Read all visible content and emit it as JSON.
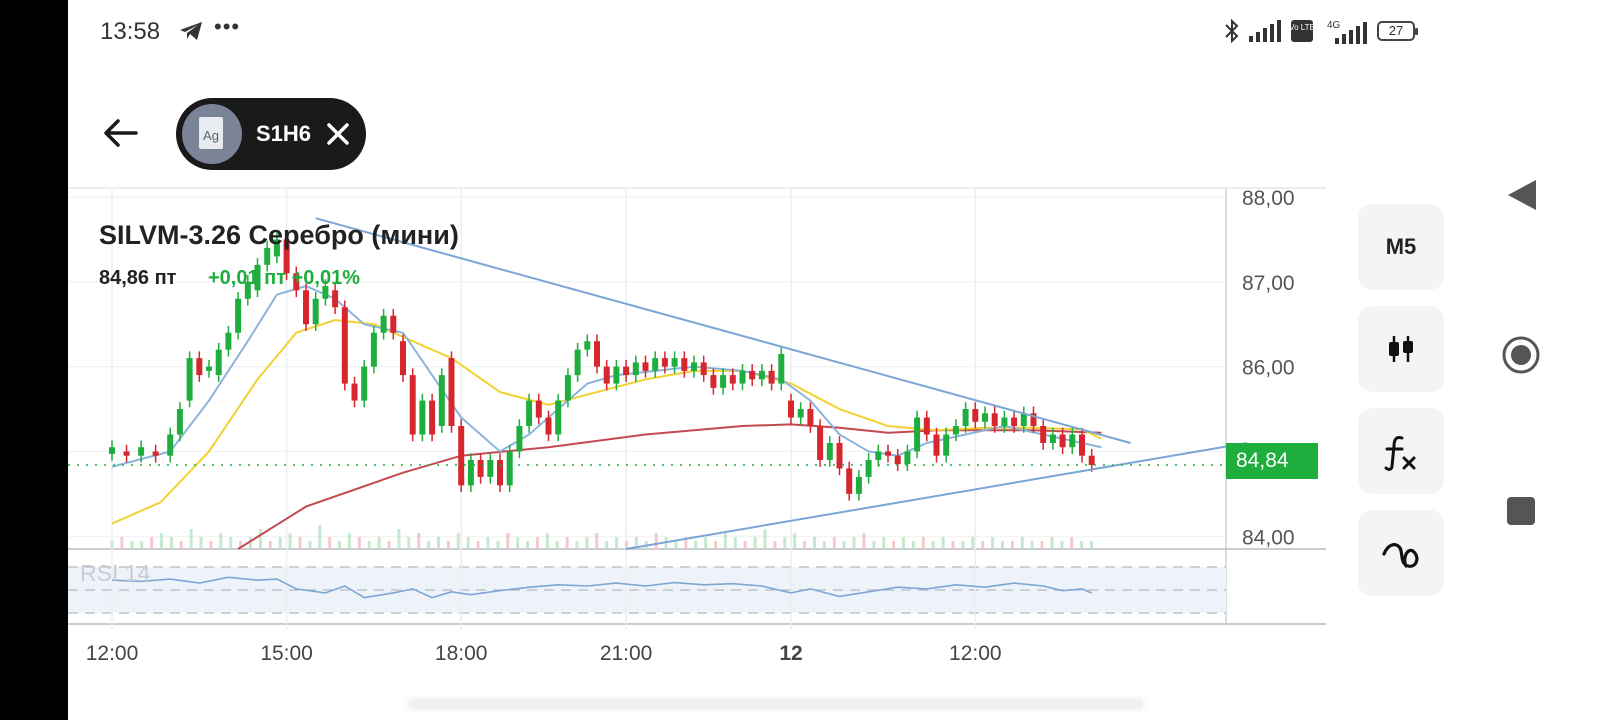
{
  "status_bar": {
    "time": "13:58",
    "dots": "•••",
    "volte": "Vo LTE",
    "network": "4G",
    "battery": "27"
  },
  "header": {
    "instrument_chip_label": "S1H6",
    "chip_logo_text": "Ag"
  },
  "instrument": {
    "title": "SILVM-3.26 Серебро (мини)",
    "price": "84,86 пт",
    "change": "+0,01 пт +0,01%"
  },
  "price_tag": "84,84",
  "rsi_label": "RSI 14",
  "toolbar": {
    "timeframe_label": "M5"
  },
  "colors": {
    "up": "#1fae3d",
    "down": "#d6262e",
    "ma_blue": "#8ab4dc",
    "ma_yellow": "#f2d230",
    "ma_red": "#c44a52",
    "trendline": "#7aa5d6"
  },
  "chart_data": {
    "type": "candlestick",
    "y_ticks": [
      "88,00",
      "87,00",
      "86,00",
      "84,00"
    ],
    "ylim": [
      83.85,
      88.0
    ],
    "x_ticks": [
      "12:00",
      "15:00",
      "18:00",
      "21:00",
      "12",
      "12:00"
    ],
    "x_tick_values": [
      0,
      36,
      72,
      106,
      140,
      178
    ],
    "current_price_line": 84.84,
    "candles": [
      {
        "t": 0,
        "o": 84.97,
        "c": 85.05
      },
      {
        "t": 3,
        "o": 85.0,
        "c": 84.95
      },
      {
        "t": 6,
        "o": 84.95,
        "c": 85.05
      },
      {
        "t": 9,
        "o": 85.0,
        "c": 84.95
      },
      {
        "t": 12,
        "o": 84.95,
        "c": 85.2
      },
      {
        "t": 14,
        "o": 85.2,
        "c": 85.5
      },
      {
        "t": 16,
        "o": 85.6,
        "c": 86.1
      },
      {
        "t": 18,
        "o": 86.1,
        "c": 85.9
      },
      {
        "t": 20,
        "o": 85.95,
        "c": 86.0
      },
      {
        "t": 22,
        "o": 85.9,
        "c": 86.2
      },
      {
        "t": 24,
        "o": 86.2,
        "c": 86.4
      },
      {
        "t": 26,
        "o": 86.4,
        "c": 86.8
      },
      {
        "t": 28,
        "o": 86.8,
        "c": 87.0
      },
      {
        "t": 30,
        "o": 86.9,
        "c": 87.2
      },
      {
        "t": 32,
        "o": 87.2,
        "c": 87.4
      },
      {
        "t": 34,
        "o": 87.3,
        "c": 87.5
      },
      {
        "t": 36,
        "o": 87.5,
        "c": 87.1
      },
      {
        "t": 38,
        "o": 87.1,
        "c": 86.9
      },
      {
        "t": 40,
        "o": 86.9,
        "c": 86.5
      },
      {
        "t": 42,
        "o": 86.5,
        "c": 86.8
      },
      {
        "t": 44,
        "o": 86.8,
        "c": 86.95
      },
      {
        "t": 46,
        "o": 86.9,
        "c": 86.7
      },
      {
        "t": 48,
        "o": 86.7,
        "c": 85.8
      },
      {
        "t": 50,
        "o": 85.8,
        "c": 85.6
      },
      {
        "t": 52,
        "o": 85.6,
        "c": 86.0
      },
      {
        "t": 54,
        "o": 86.0,
        "c": 86.4
      },
      {
        "t": 56,
        "o": 86.4,
        "c": 86.6
      },
      {
        "t": 58,
        "o": 86.6,
        "c": 86.4
      },
      {
        "t": 60,
        "o": 86.3,
        "c": 85.9
      },
      {
        "t": 62,
        "o": 85.9,
        "c": 85.2
      },
      {
        "t": 64,
        "o": 85.2,
        "c": 85.6
      },
      {
        "t": 66,
        "o": 85.6,
        "c": 85.2
      },
      {
        "t": 68,
        "o": 85.3,
        "c": 85.9
      },
      {
        "t": 70,
        "o": 86.1,
        "c": 85.3
      },
      {
        "t": 72,
        "o": 85.3,
        "c": 84.6
      },
      {
        "t": 74,
        "o": 84.6,
        "c": 84.9
      },
      {
        "t": 76,
        "o": 84.9,
        "c": 84.7
      },
      {
        "t": 78,
        "o": 84.7,
        "c": 84.9
      },
      {
        "t": 80,
        "o": 84.9,
        "c": 84.6
      },
      {
        "t": 82,
        "o": 84.6,
        "c": 85.0
      },
      {
        "t": 84,
        "o": 85.0,
        "c": 85.3
      },
      {
        "t": 86,
        "o": 85.3,
        "c": 85.6
      },
      {
        "t": 88,
        "o": 85.6,
        "c": 85.4
      },
      {
        "t": 90,
        "o": 85.4,
        "c": 85.2
      },
      {
        "t": 92,
        "o": 85.2,
        "c": 85.6
      },
      {
        "t": 94,
        "o": 85.6,
        "c": 85.9
      },
      {
        "t": 96,
        "o": 85.9,
        "c": 86.2
      },
      {
        "t": 98,
        "o": 86.2,
        "c": 86.3
      },
      {
        "t": 100,
        "o": 86.3,
        "c": 86.0
      },
      {
        "t": 102,
        "o": 86.0,
        "c": 85.8
      },
      {
        "t": 104,
        "o": 85.8,
        "c": 86.0
      },
      {
        "t": 106,
        "o": 86.0,
        "c": 85.9
      },
      {
        "t": 108,
        "o": 85.9,
        "c": 86.05
      },
      {
        "t": 110,
        "o": 86.05,
        "c": 85.95
      },
      {
        "t": 112,
        "o": 85.95,
        "c": 86.1
      },
      {
        "t": 114,
        "o": 86.1,
        "c": 86.0
      },
      {
        "t": 116,
        "o": 86.0,
        "c": 86.1
      },
      {
        "t": 118,
        "o": 86.1,
        "c": 85.95
      },
      {
        "t": 120,
        "o": 85.95,
        "c": 86.05
      },
      {
        "t": 122,
        "o": 86.05,
        "c": 85.9
      },
      {
        "t": 124,
        "o": 85.9,
        "c": 85.75
      },
      {
        "t": 126,
        "o": 85.75,
        "c": 85.9
      },
      {
        "t": 128,
        "o": 85.9,
        "c": 85.8
      },
      {
        "t": 130,
        "o": 85.8,
        "c": 85.95
      },
      {
        "t": 132,
        "o": 85.95,
        "c": 85.85
      },
      {
        "t": 134,
        "o": 85.85,
        "c": 85.95
      },
      {
        "t": 136,
        "o": 85.95,
        "c": 85.8
      },
      {
        "t": 138,
        "o": 85.8,
        "c": 86.15
      },
      {
        "t": 140,
        "o": 85.6,
        "c": 85.4
      },
      {
        "t": 142,
        "o": 85.4,
        "c": 85.5
      },
      {
        "t": 144,
        "o": 85.5,
        "c": 85.3
      },
      {
        "t": 146,
        "o": 85.3,
        "c": 84.9
      },
      {
        "t": 148,
        "o": 84.9,
        "c": 85.1
      },
      {
        "t": 150,
        "o": 85.1,
        "c": 84.8
      },
      {
        "t": 152,
        "o": 84.8,
        "c": 84.5
      },
      {
        "t": 154,
        "o": 84.5,
        "c": 84.7
      },
      {
        "t": 156,
        "o": 84.7,
        "c": 84.9
      },
      {
        "t": 158,
        "o": 84.9,
        "c": 85.0
      },
      {
        "t": 160,
        "o": 85.0,
        "c": 84.95
      },
      {
        "t": 162,
        "o": 84.95,
        "c": 84.85
      },
      {
        "t": 164,
        "o": 84.85,
        "c": 85.0
      },
      {
        "t": 166,
        "o": 85.0,
        "c": 85.4
      },
      {
        "t": 168,
        "o": 85.4,
        "c": 85.2
      },
      {
        "t": 170,
        "o": 85.2,
        "c": 84.95
      },
      {
        "t": 172,
        "o": 84.95,
        "c": 85.2
      },
      {
        "t": 174,
        "o": 85.2,
        "c": 85.3
      },
      {
        "t": 176,
        "o": 85.3,
        "c": 85.5
      },
      {
        "t": 178,
        "o": 85.5,
        "c": 85.35
      },
      {
        "t": 180,
        "o": 85.35,
        "c": 85.45
      },
      {
        "t": 182,
        "o": 85.45,
        "c": 85.3
      },
      {
        "t": 184,
        "o": 85.3,
        "c": 85.4
      },
      {
        "t": 186,
        "o": 85.4,
        "c": 85.3
      },
      {
        "t": 188,
        "o": 85.3,
        "c": 85.45
      },
      {
        "t": 190,
        "o": 85.45,
        "c": 85.3
      },
      {
        "t": 192,
        "o": 85.3,
        "c": 85.1
      },
      {
        "t": 194,
        "o": 85.1,
        "c": 85.2
      },
      {
        "t": 196,
        "o": 85.2,
        "c": 85.05
      },
      {
        "t": 198,
        "o": 85.05,
        "c": 85.2
      },
      {
        "t": 200,
        "o": 85.2,
        "c": 84.95
      },
      {
        "t": 202,
        "o": 84.95,
        "c": 84.84
      }
    ],
    "ma_blue": [
      [
        0,
        84.82
      ],
      [
        12,
        85.0
      ],
      [
        20,
        85.6
      ],
      [
        28,
        86.3
      ],
      [
        34,
        86.85
      ],
      [
        40,
        86.95
      ],
      [
        46,
        86.8
      ],
      [
        52,
        86.5
      ],
      [
        60,
        86.4
      ],
      [
        66,
        85.9
      ],
      [
        72,
        85.4
      ],
      [
        80,
        85.0
      ],
      [
        86,
        85.2
      ],
      [
        92,
        85.5
      ],
      [
        98,
        85.8
      ],
      [
        104,
        85.9
      ],
      [
        112,
        85.95
      ],
      [
        120,
        86.0
      ],
      [
        130,
        85.95
      ],
      [
        138,
        85.85
      ],
      [
        144,
        85.6
      ],
      [
        150,
        85.2
      ],
      [
        156,
        85.0
      ],
      [
        162,
        84.95
      ],
      [
        168,
        85.1
      ],
      [
        176,
        85.2
      ],
      [
        184,
        85.3
      ],
      [
        192,
        85.2
      ],
      [
        200,
        85.1
      ],
      [
        204,
        85.05
      ]
    ],
    "ma_yellow": [
      [
        0,
        84.15
      ],
      [
        10,
        84.4
      ],
      [
        20,
        85.0
      ],
      [
        30,
        85.85
      ],
      [
        38,
        86.4
      ],
      [
        46,
        86.55
      ],
      [
        54,
        86.5
      ],
      [
        62,
        86.3
      ],
      [
        70,
        86.1
      ],
      [
        80,
        85.7
      ],
      [
        90,
        85.55
      ],
      [
        100,
        85.7
      ],
      [
        110,
        85.85
      ],
      [
        120,
        85.95
      ],
      [
        130,
        85.95
      ],
      [
        140,
        85.8
      ],
      [
        150,
        85.5
      ],
      [
        160,
        85.3
      ],
      [
        170,
        85.25
      ],
      [
        180,
        85.28
      ],
      [
        190,
        85.28
      ],
      [
        200,
        85.26
      ],
      [
        204,
        85.15
      ]
    ],
    "ma_red": [
      [
        26,
        83.85
      ],
      [
        40,
        84.35
      ],
      [
        60,
        84.75
      ],
      [
        72,
        84.95
      ],
      [
        90,
        85.05
      ],
      [
        110,
        85.2
      ],
      [
        130,
        85.3
      ],
      [
        140,
        85.32
      ],
      [
        150,
        85.28
      ],
      [
        160,
        85.22
      ],
      [
        170,
        85.25
      ],
      [
        190,
        85.25
      ],
      [
        204,
        85.22
      ]
    ],
    "trendline_upper": [
      [
        42,
        87.75
      ],
      [
        210,
        85.1
      ]
    ],
    "trendline_lower": [
      [
        106,
        83.85
      ],
      [
        234,
        85.1
      ]
    ],
    "rsi": [
      [
        0,
        60
      ],
      [
        6,
        58
      ],
      [
        12,
        62
      ],
      [
        18,
        55
      ],
      [
        24,
        65
      ],
      [
        30,
        60
      ],
      [
        34,
        62
      ],
      [
        38,
        45
      ],
      [
        44,
        38
      ],
      [
        48,
        50
      ],
      [
        52,
        30
      ],
      [
        58,
        38
      ],
      [
        62,
        45
      ],
      [
        66,
        30
      ],
      [
        70,
        40
      ],
      [
        74,
        35
      ],
      [
        80,
        42
      ],
      [
        86,
        48
      ],
      [
        92,
        52
      ],
      [
        98,
        50
      ],
      [
        104,
        55
      ],
      [
        110,
        50
      ],
      [
        116,
        56
      ],
      [
        122,
        52
      ],
      [
        128,
        54
      ],
      [
        134,
        50
      ],
      [
        140,
        38
      ],
      [
        144,
        45
      ],
      [
        150,
        32
      ],
      [
        156,
        40
      ],
      [
        162,
        48
      ],
      [
        168,
        45
      ],
      [
        174,
        52
      ],
      [
        180,
        48
      ],
      [
        186,
        55
      ],
      [
        192,
        50
      ],
      [
        196,
        42
      ],
      [
        200,
        45
      ],
      [
        202,
        38
      ]
    ],
    "volume": [
      2,
      3,
      2,
      2,
      3,
      4,
      3,
      2,
      5,
      3,
      2,
      4,
      3,
      2,
      3,
      5,
      2,
      3,
      4,
      3,
      2,
      6,
      3,
      2,
      4,
      3,
      2,
      3,
      2,
      5,
      3,
      4,
      2,
      3,
      2,
      4,
      3,
      2,
      3,
      2,
      4,
      3,
      2,
      3,
      4,
      2,
      3,
      2,
      3,
      4,
      2,
      3,
      2,
      3,
      2,
      4,
      3,
      2,
      3,
      2,
      3,
      2,
      4,
      3,
      2,
      3,
      5,
      2,
      3,
      4,
      2,
      3,
      2,
      3,
      2,
      3,
      4,
      2,
      3,
      2,
      3,
      2,
      3,
      2,
      3,
      2,
      2,
      3,
      2,
      3,
      2,
      2,
      3,
      2,
      2,
      3,
      2,
      3,
      2,
      2
    ]
  }
}
